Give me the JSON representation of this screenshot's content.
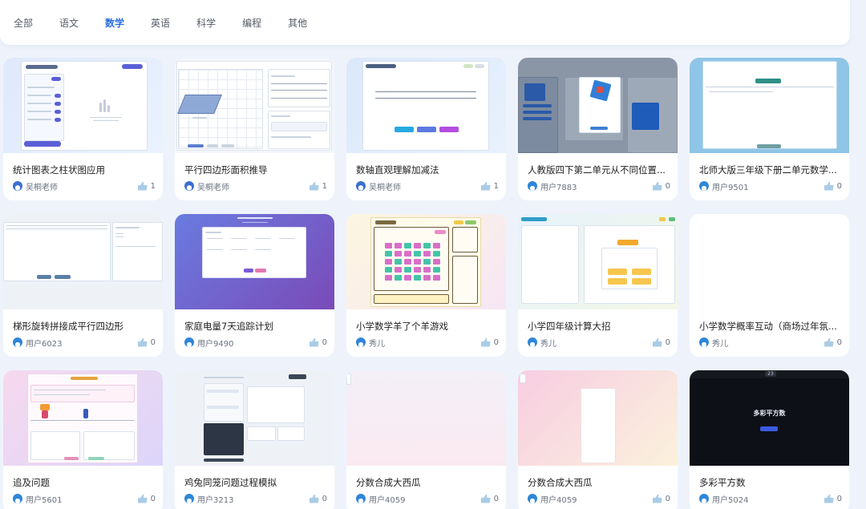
{
  "tabs": [
    {
      "label": "全部",
      "active": false
    },
    {
      "label": "语文",
      "active": false
    },
    {
      "label": "数学",
      "active": true
    },
    {
      "label": "英语",
      "active": false
    },
    {
      "label": "科学",
      "active": false
    },
    {
      "label": "编程",
      "active": false
    },
    {
      "label": "其他",
      "active": false
    }
  ],
  "cards": [
    {
      "title": "统计图表之柱状图应用",
      "author": "吴桐老师",
      "likes": "1"
    },
    {
      "title": "平行四边形面积推导",
      "author": "吴桐老师",
      "likes": "1"
    },
    {
      "title": "数轴直观理解加减法",
      "author": "吴桐老师",
      "likes": "1"
    },
    {
      "title": "人教版四下第二单元从不同位置...",
      "author": "用户7883",
      "likes": "0"
    },
    {
      "title": "北师大版三年级下册二单元数学...",
      "author": "用户9501",
      "likes": "0"
    },
    {
      "title": "梯形旋转拼接成平行四边形",
      "author": "用户6023",
      "likes": "0"
    },
    {
      "title": "家庭电量7天追踪计划",
      "author": "用户9490",
      "likes": "0"
    },
    {
      "title": "小学数学羊了个羊游戏",
      "author": "秀儿",
      "likes": "0"
    },
    {
      "title": "小学四年级计算大招",
      "author": "秀儿",
      "likes": "0"
    },
    {
      "title": "小学数学概率互动（商场过年氛...",
      "author": "秀儿",
      "likes": "0"
    },
    {
      "title": "追及问题",
      "author": "用户5601",
      "likes": "0"
    },
    {
      "title": "鸡兔同笼问题过程模拟",
      "author": "用户3213",
      "likes": "0"
    },
    {
      "title": "分数合成大西瓜",
      "author": "用户4059",
      "likes": "0"
    },
    {
      "title": "分数合成大西瓜",
      "author": "用户4059",
      "likes": "0"
    },
    {
      "title": "多彩平方数",
      "author": "用户5024",
      "likes": "0"
    }
  ],
  "thumb_texts": {
    "dark_title": "多彩平方数",
    "game_badge": "23"
  },
  "colors": {
    "accent": "#2b6fe6",
    "like_icon": "#a9cce6"
  }
}
